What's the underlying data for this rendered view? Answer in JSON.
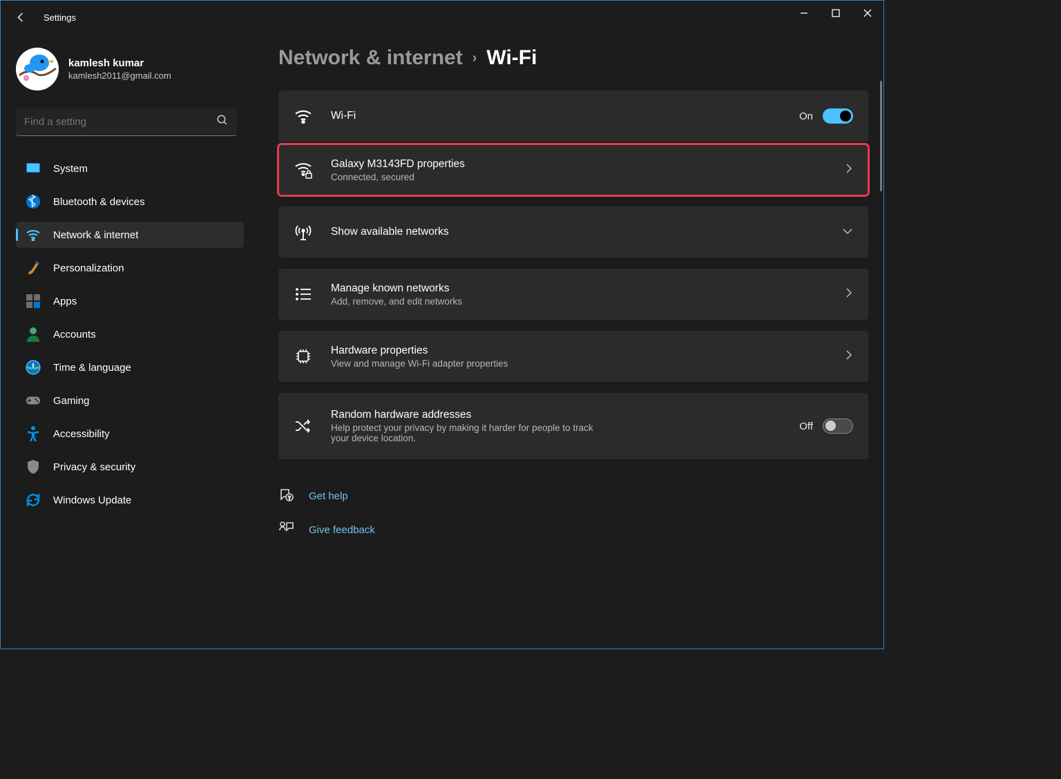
{
  "window": {
    "title": "Settings"
  },
  "user": {
    "name": "kamlesh kumar",
    "email": "kamlesh2011@gmail.com"
  },
  "search": {
    "placeholder": "Find a setting"
  },
  "sidebar": {
    "items": [
      {
        "label": "System"
      },
      {
        "label": "Bluetooth & devices"
      },
      {
        "label": "Network & internet"
      },
      {
        "label": "Personalization"
      },
      {
        "label": "Apps"
      },
      {
        "label": "Accounts"
      },
      {
        "label": "Time & language"
      },
      {
        "label": "Gaming"
      },
      {
        "label": "Accessibility"
      },
      {
        "label": "Privacy & security"
      },
      {
        "label": "Windows Update"
      }
    ]
  },
  "breadcrumb": {
    "parent": "Network & internet",
    "current": "Wi-Fi"
  },
  "cards": {
    "wifi": {
      "title": "Wi-Fi",
      "state": "On"
    },
    "network": {
      "title": "Galaxy M3143FD properties",
      "sub": "Connected, secured"
    },
    "available": {
      "title": "Show available networks"
    },
    "known": {
      "title": "Manage known networks",
      "sub": "Add, remove, and edit networks"
    },
    "hardware": {
      "title": "Hardware properties",
      "sub": "View and manage Wi-Fi adapter properties"
    },
    "random": {
      "title": "Random hardware addresses",
      "sub": "Help protect your privacy by making it harder for people to track your device location.",
      "state": "Off"
    }
  },
  "footer": {
    "help": "Get help",
    "feedback": "Give feedback"
  }
}
